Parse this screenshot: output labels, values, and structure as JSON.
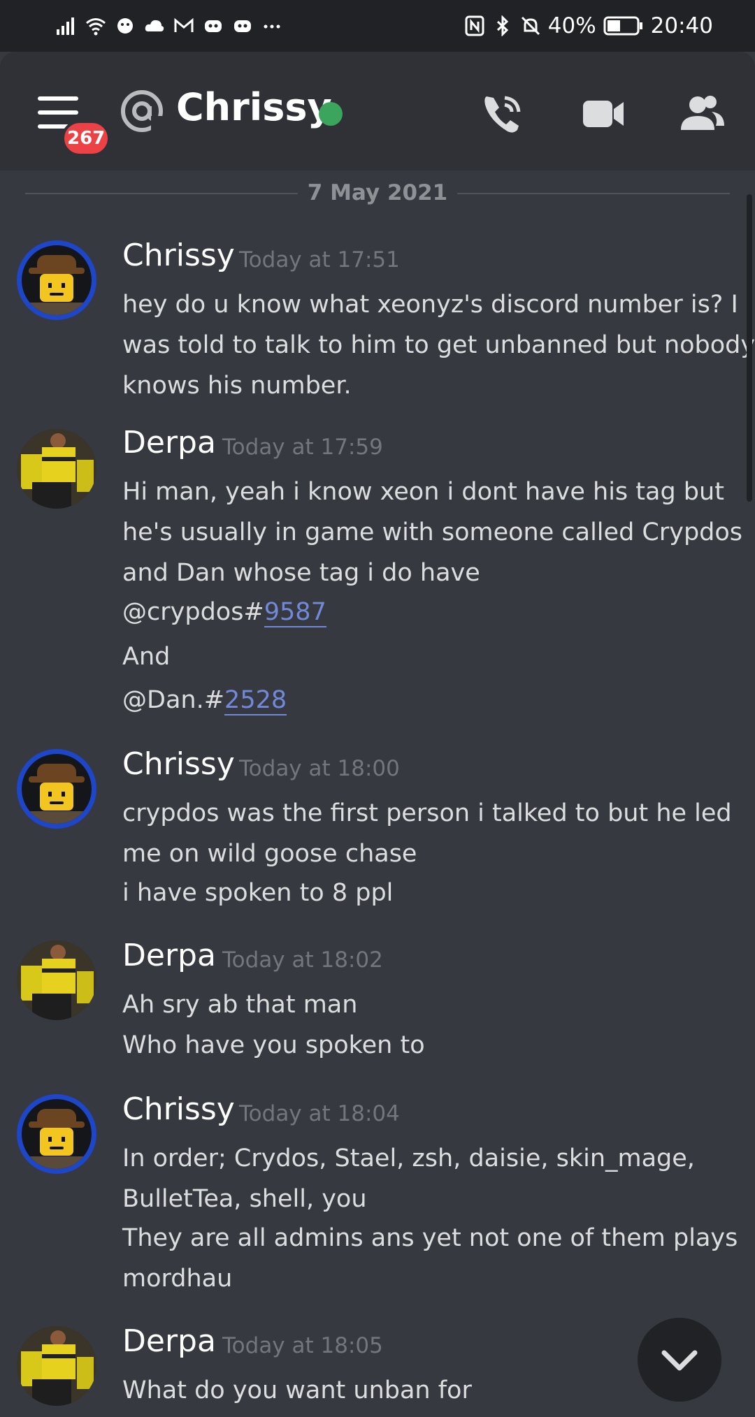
{
  "status_bar": {
    "battery": "40%",
    "time": "20:40"
  },
  "header": {
    "badge_count": "267",
    "channel_name": "Chrissy",
    "online": true
  },
  "date_divider": "7 May 2021",
  "messages": [
    {
      "author": "Chrissy",
      "timestamp": "Today at 17:51",
      "lines": [
        "hey do u know what xeonyz's discord number is?  I",
        "was told to talk to him to get unbanned but nobody",
        "knows his number."
      ]
    },
    {
      "author": "Derpa",
      "timestamp": "Today at 17:59",
      "lines": [
        "Hi man, yeah i know xeon i dont have his tag but",
        "he's usually in game with someone called Crypdos",
        "and Dan whose tag i do have"
      ],
      "mention1_prefix": "@crypdos#",
      "mention1_link": "9587",
      "and_line": "And",
      "mention2_prefix": "@Dan.#",
      "mention2_link": "2528"
    },
    {
      "author": "Chrissy",
      "timestamp": "Today at 18:00",
      "lines": [
        "crypdos was the first person i talked to but he led",
        "me on wild goose chase",
        "i have spoken to 8 ppl"
      ]
    },
    {
      "author": "Derpa",
      "timestamp": "Today at 18:02",
      "lines": [
        "Ah sry ab that man",
        "Who have you spoken to"
      ]
    },
    {
      "author": "Chrissy",
      "timestamp": "Today at 18:04",
      "lines": [
        "In order;  Crydos, Stael, zsh, daisie, skin_mage,",
        "BulletTea, shell, you",
        "They are all admins ans yet not one of them plays",
        "mordhau"
      ]
    },
    {
      "author": "Derpa",
      "timestamp": "Today at 18:05",
      "lines": [
        "What do you want unban for"
      ]
    }
  ],
  "colors": {
    "background": "#36393f",
    "header": "#2f3136",
    "online": "#3ba55d",
    "badge": "#ed4245",
    "link": "#7289da"
  }
}
